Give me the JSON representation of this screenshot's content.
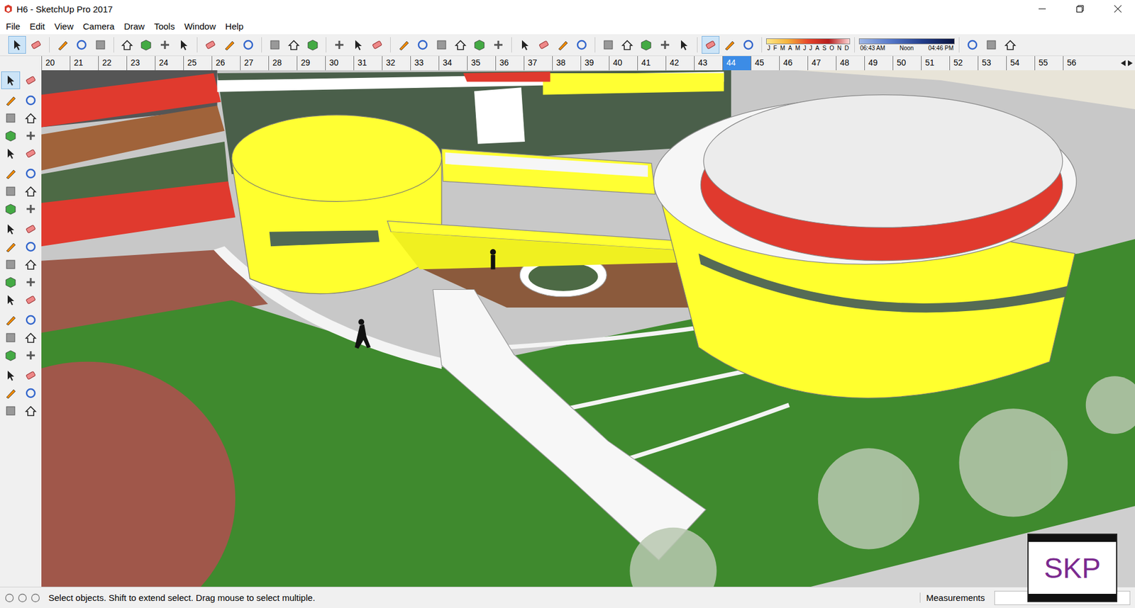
{
  "window": {
    "title": "H6 - SketchUp Pro 2017"
  },
  "menu": [
    "File",
    "Edit",
    "View",
    "Camera",
    "Draw",
    "Tools",
    "Window",
    "Help"
  ],
  "toolbar": [
    {
      "selected": true
    },
    {
      "selected": false
    },
    {
      "selected": false
    },
    {
      "selected": false
    },
    {
      "selected": false
    },
    {
      "selected": false
    },
    {
      "selected": false
    },
    {
      "selected": false
    },
    {
      "selected": false
    },
    {
      "selected": false
    },
    {
      "selected": false
    },
    {
      "selected": false
    },
    {
      "selected": false
    },
    {
      "selected": false
    },
    {
      "selected": false
    },
    {
      "selected": false
    },
    {
      "selected": false
    },
    {
      "selected": false
    },
    {
      "selected": false
    },
    {
      "selected": false
    },
    {
      "selected": false
    },
    {
      "selected": false
    },
    {
      "selected": false
    },
    {
      "selected": false
    },
    {
      "selected": false
    },
    {
      "selected": false
    },
    {
      "selected": false
    },
    {
      "selected": false
    },
    {
      "selected": false
    },
    {
      "selected": false
    },
    {
      "selected": false
    },
    {
      "selected": false
    },
    {
      "selected": false
    },
    {
      "selected": true
    },
    {
      "selected": false
    },
    {
      "selected": false
    }
  ],
  "shadows": {
    "months": [
      "J",
      "F",
      "M",
      "A",
      "M",
      "J",
      "J",
      "A",
      "S",
      "O",
      "N",
      "D"
    ],
    "times": [
      "06:43 AM",
      "Noon",
      "04:46 PM"
    ]
  },
  "extensions": [
    {
      "selected": false
    },
    {
      "selected": false
    },
    {
      "selected": false
    }
  ],
  "ruler": [
    {
      "label": "20",
      "selected": false
    },
    {
      "label": "21",
      "selected": false
    },
    {
      "label": "22",
      "selected": false
    },
    {
      "label": "23",
      "selected": false
    },
    {
      "label": "24",
      "selected": false
    },
    {
      "label": "25",
      "selected": false
    },
    {
      "label": "26",
      "selected": false
    },
    {
      "label": "27",
      "selected": false
    },
    {
      "label": "28",
      "selected": false
    },
    {
      "label": "29",
      "selected": false
    },
    {
      "label": "30",
      "selected": false
    },
    {
      "label": "31",
      "selected": false
    },
    {
      "label": "32",
      "selected": false
    },
    {
      "label": "33",
      "selected": false
    },
    {
      "label": "34",
      "selected": false
    },
    {
      "label": "35",
      "selected": false
    },
    {
      "label": "36",
      "selected": false
    },
    {
      "label": "37",
      "selected": false
    },
    {
      "label": "38",
      "selected": false
    },
    {
      "label": "39",
      "selected": false
    },
    {
      "label": "40",
      "selected": false
    },
    {
      "label": "41",
      "selected": false
    },
    {
      "label": "42",
      "selected": false
    },
    {
      "label": "43",
      "selected": false
    },
    {
      "label": "44",
      "selected": true
    },
    {
      "label": "45",
      "selected": false
    },
    {
      "label": "46",
      "selected": false
    },
    {
      "label": "47",
      "selected": false
    },
    {
      "label": "48",
      "selected": false
    },
    {
      "label": "49",
      "selected": false
    },
    {
      "label": "50",
      "selected": false
    },
    {
      "label": "51",
      "selected": false
    },
    {
      "label": "52",
      "selected": false
    },
    {
      "label": "53",
      "selected": false
    },
    {
      "label": "54",
      "selected": false
    },
    {
      "label": "55",
      "selected": false
    },
    {
      "label": "56",
      "selected": false
    }
  ],
  "tool_palette": [
    {
      "selected": true
    },
    {
      "selected": false
    },
    {
      "selected": false
    },
    {
      "selected": false
    },
    {
      "selected": false
    },
    {
      "selected": false
    },
    {
      "selected": false
    },
    {
      "selected": false
    },
    {
      "selected": false
    },
    {
      "selected": false
    },
    {
      "selected": false
    },
    {
      "selected": false
    },
    {
      "selected": false
    },
    {
      "selected": false
    },
    {
      "selected": false
    },
    {
      "selected": false
    },
    {
      "selected": false
    },
    {
      "selected": false
    },
    {
      "selected": false
    },
    {
      "selected": false
    },
    {
      "selected": false
    },
    {
      "selected": false
    },
    {
      "selected": false
    },
    {
      "selected": false
    },
    {
      "selected": false
    },
    {
      "selected": false
    },
    {
      "selected": false
    },
    {
      "selected": false
    },
    {
      "selected": false
    },
    {
      "selected": false
    },
    {
      "selected": false
    },
    {
      "selected": false
    },
    {
      "selected": false
    },
    {
      "selected": false
    },
    {
      "selected": false
    },
    {
      "selected": false
    },
    {
      "selected": false
    },
    {
      "selected": false
    }
  ],
  "status_bar": {
    "hint": "Select objects. Shift to extend select. Drag mouse to select multiple.",
    "measurements_label": "Measurements",
    "measurements_value": ""
  },
  "badge": "SKP"
}
